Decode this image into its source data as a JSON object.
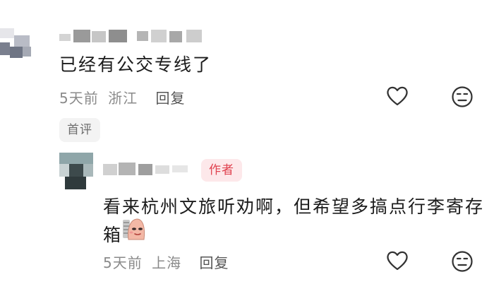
{
  "comments": [
    {
      "text": "已经有公交专线了",
      "time": "5天前",
      "location": "浙江",
      "reply_label": "回复",
      "badge": "首评"
    },
    {
      "author_badge": "作者",
      "text_line1": "看来杭州文旅听劝啊，但希望多搞点行李寄存",
      "text_line2": "箱",
      "time": "5天前",
      "location": "上海",
      "reply_label": "回复"
    }
  ],
  "icons": {
    "like": "heart-outline-icon",
    "dislike": "unhappy-face-icon",
    "emoji": "sticker-emoji"
  },
  "colors": {
    "author_badge_bg": "#fde8ea",
    "author_badge_text": "#e0424f",
    "meta_text": "#8a8a8a"
  }
}
